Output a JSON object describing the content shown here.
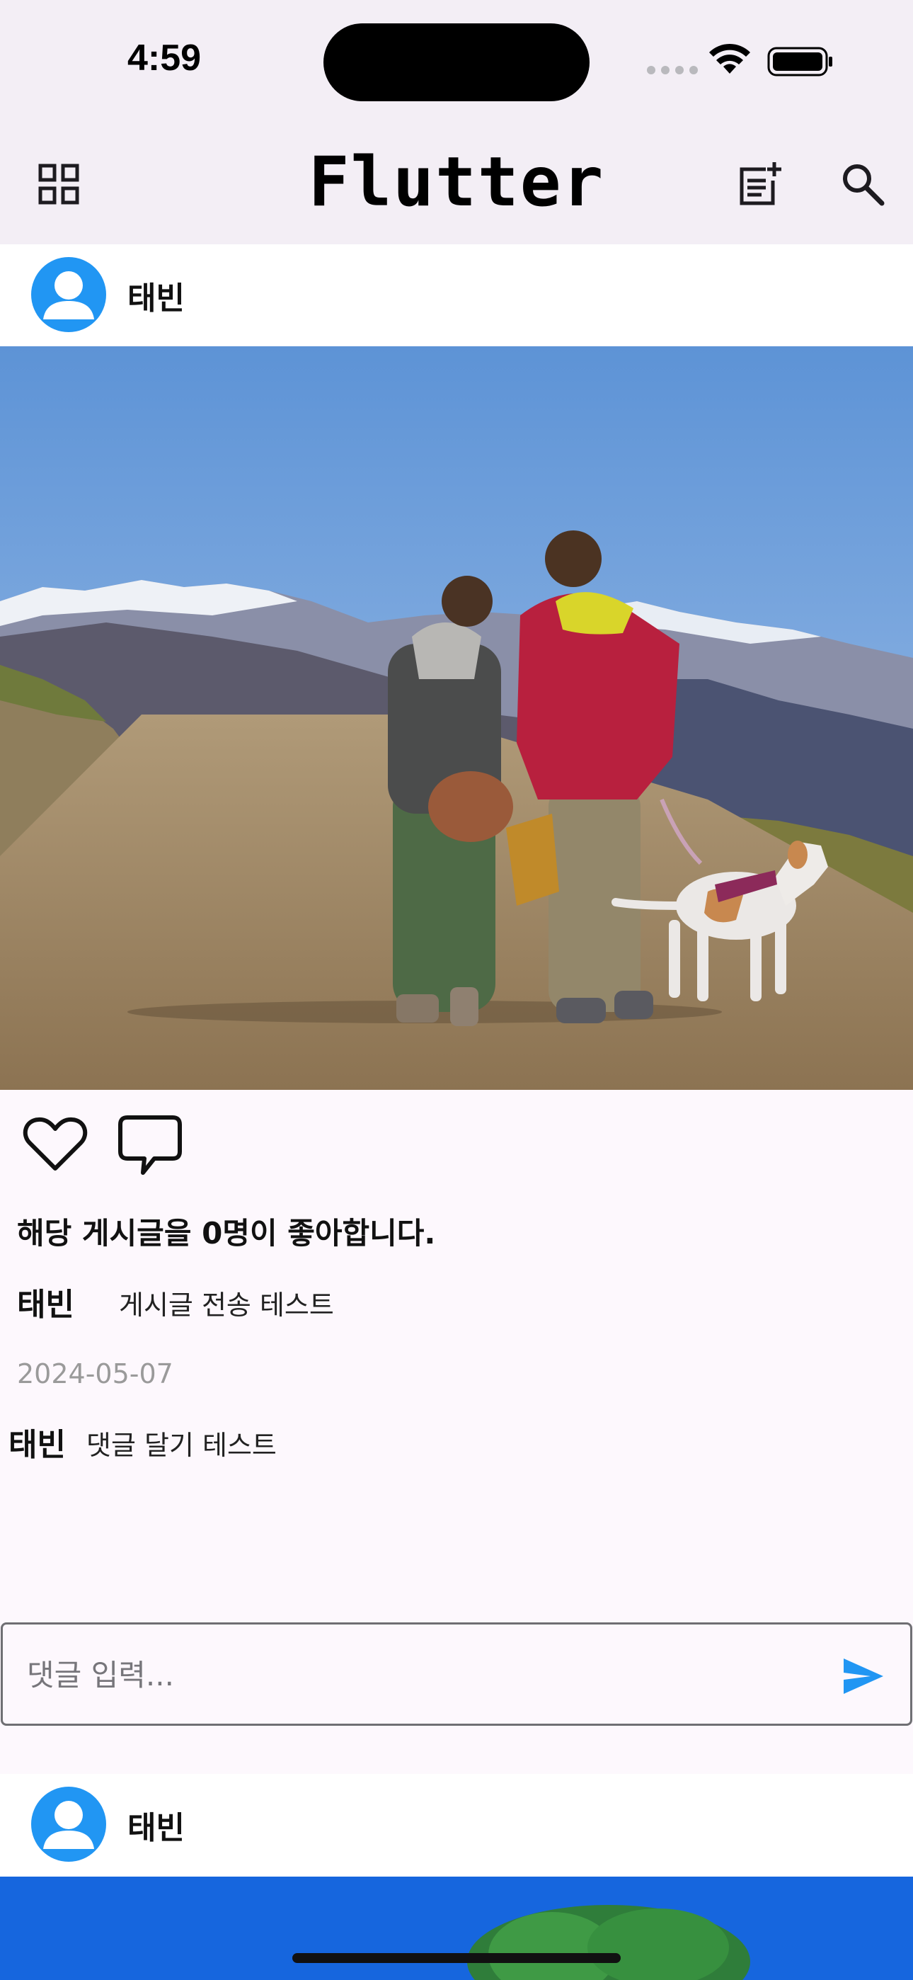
{
  "status_bar": {
    "time": "4:59"
  },
  "app_bar": {
    "title": "Flutter"
  },
  "posts": [
    {
      "author": "태빈",
      "likes_text": "해당 게시글을 0명이 좋아합니다.",
      "caption": {
        "author": "태빈",
        "text": "게시글 전송 테스트"
      },
      "date": "2024-05-07",
      "comments": [
        {
          "author": "태빈",
          "text": "댓글 달기 테스트"
        }
      ],
      "comment_input": {
        "placeholder": "댓글 입력..."
      }
    },
    {
      "author": "태빈"
    }
  ],
  "icons": {
    "grid": "grid-view-icon",
    "new_post": "post-add-icon",
    "search": "search-icon",
    "like": "heart-outline-icon",
    "comment": "chat-bubble-outline-icon",
    "send": "send-icon",
    "avatar": "person-icon"
  },
  "colors": {
    "app_bar_bg": "#f3eef5",
    "accent": "#2196f3",
    "date_gray": "#9a9a9a"
  }
}
